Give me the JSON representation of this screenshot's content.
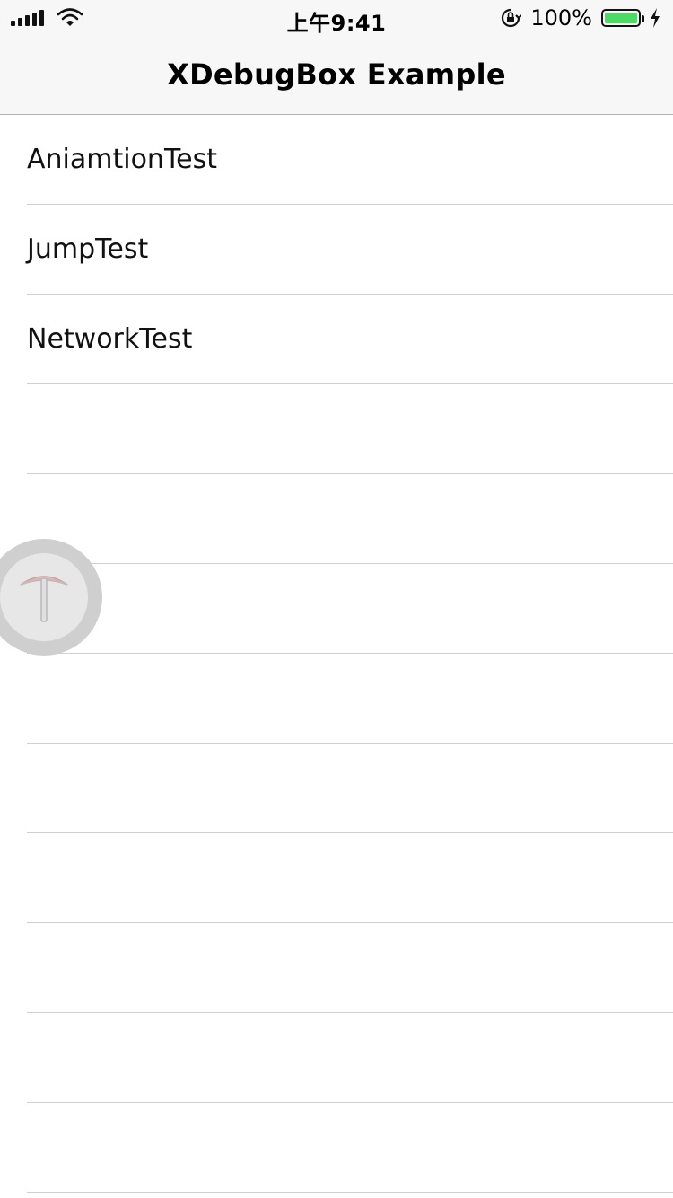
{
  "status_bar": {
    "time": "上午9:41",
    "battery_percent_text": "100%",
    "battery_level": 1.0,
    "battery_color": "#4cd964",
    "icons": [
      "signal-icon",
      "wifi-icon",
      "orientation-lock-icon",
      "battery-icon",
      "charging-bolt-icon"
    ]
  },
  "nav": {
    "title": "XDebugBox Example"
  },
  "rows": [
    {
      "label": "AniamtionTest"
    },
    {
      "label": "JumpTest"
    },
    {
      "label": "NetworkTest"
    },
    {
      "label": ""
    },
    {
      "label": ""
    },
    {
      "label": ""
    },
    {
      "label": ""
    },
    {
      "label": ""
    },
    {
      "label": ""
    },
    {
      "label": ""
    },
    {
      "label": ""
    },
    {
      "label": ""
    }
  ],
  "debug_ball": {
    "icon": "pickaxe-icon",
    "accent": "#f2b6b6"
  }
}
